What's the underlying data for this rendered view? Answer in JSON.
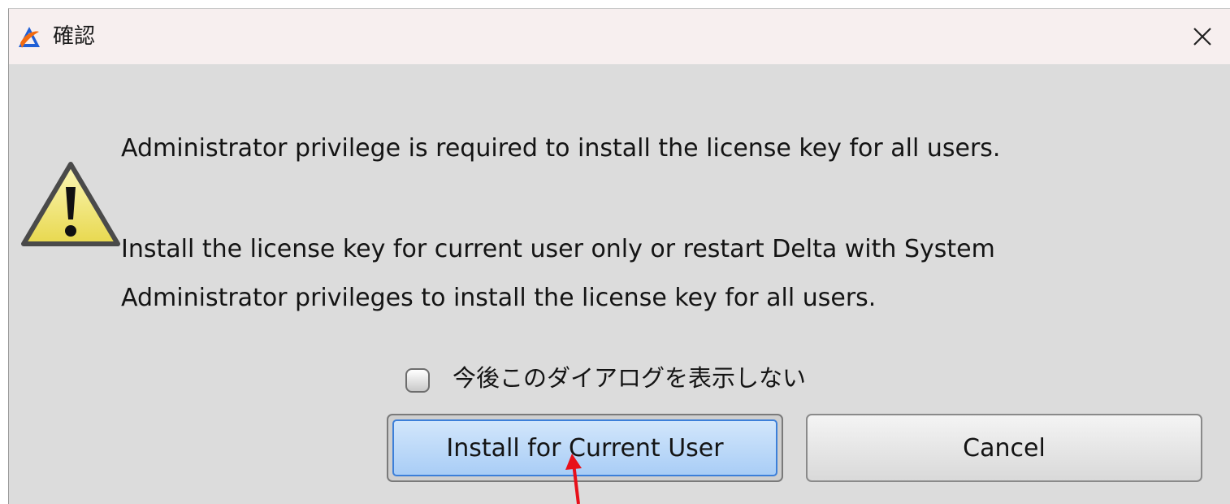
{
  "window": {
    "title": "確認",
    "close_icon": "close-icon",
    "app_icon": "delta-app-icon"
  },
  "message": {
    "line1": "Administrator privilege is required to install the license key for all users.",
    "line2": "Install the license key for current user only or restart Delta with System",
    "line3": "Administrator privileges to install the license key for all users.",
    "icon": "warning-icon"
  },
  "checkbox": {
    "label": "今後このダイアログを表示しない",
    "checked": false
  },
  "buttons": {
    "install": "Install for Current User",
    "cancel": "Cancel"
  },
  "colors": {
    "dialog_bg": "#dcdcdc",
    "titlebar_bg": "#f7efef",
    "focus_button": "#a9cdf6",
    "annotation_arrow": "#e8101a"
  }
}
